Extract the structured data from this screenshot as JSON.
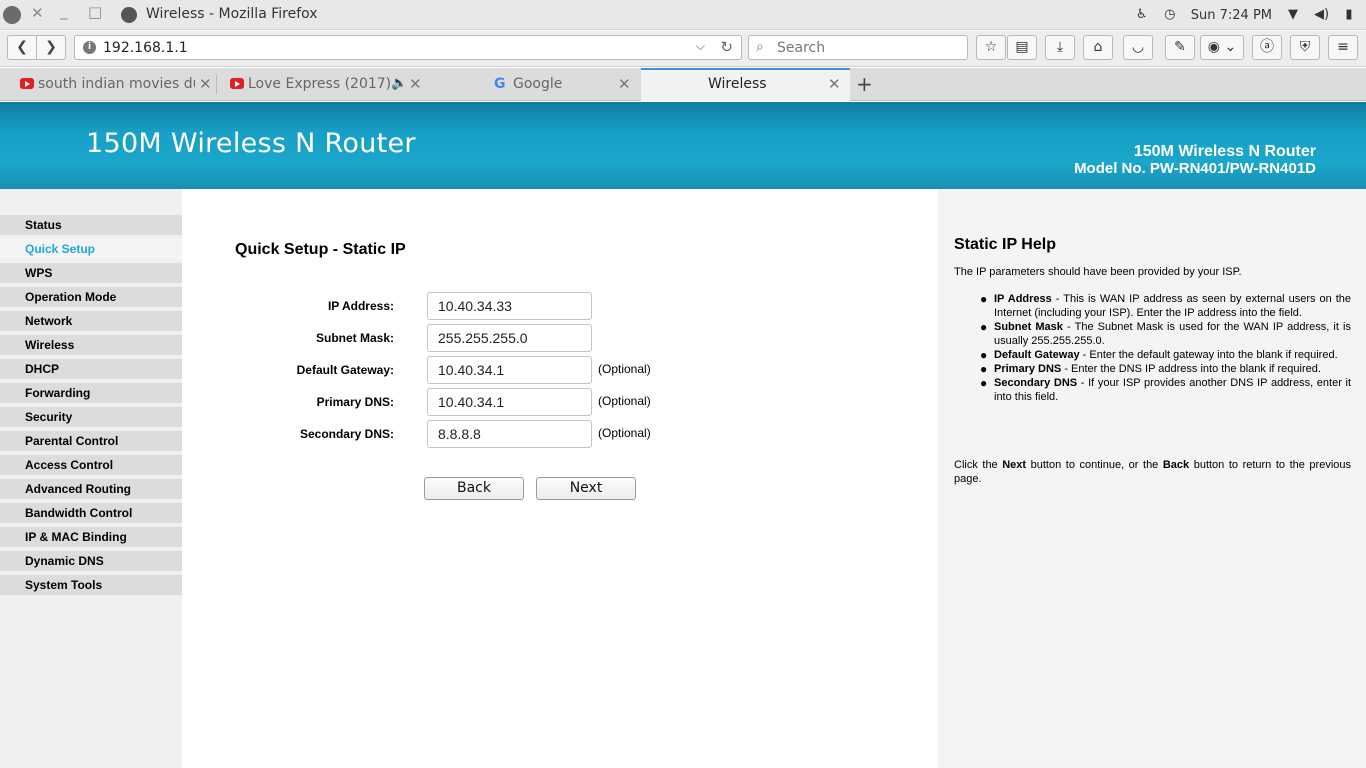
{
  "window": {
    "title": "Wireless - Mozilla Firefox",
    "clock": "Sun  7:24 PM"
  },
  "navbar": {
    "url": "192.168.1.1",
    "search_placeholder": "Search"
  },
  "tabs": [
    {
      "label": "south indian movies dub",
      "favicon": "youtube-icon"
    },
    {
      "label": "Love Express (2017)",
      "favicon": "youtube-icon",
      "audio": true
    },
    {
      "label": "Google",
      "favicon": "google-icon"
    },
    {
      "label": "Wireless",
      "active": true
    }
  ],
  "router_header": {
    "title": "150M Wireless N Router",
    "right_line1": "150M Wireless N Router",
    "right_line2": "Model No. PW-RN401/PW-RN401D"
  },
  "menu": [
    {
      "label": "Status"
    },
    {
      "label": "Quick Setup",
      "active": true
    },
    {
      "label": "WPS"
    },
    {
      "label": "Operation Mode"
    },
    {
      "label": "Network"
    },
    {
      "label": "Wireless"
    },
    {
      "label": "DHCP"
    },
    {
      "label": "Forwarding"
    },
    {
      "label": "Security"
    },
    {
      "label": "Parental Control"
    },
    {
      "label": "Access Control"
    },
    {
      "label": "Advanced Routing"
    },
    {
      "label": "Bandwidth Control"
    },
    {
      "label": "IP & MAC Binding"
    },
    {
      "label": "Dynamic DNS"
    },
    {
      "label": "System Tools"
    }
  ],
  "form": {
    "title": "Quick Setup - Static IP",
    "fields": [
      {
        "label": "IP Address:",
        "value": "10.40.34.33",
        "optional": ""
      },
      {
        "label": "Subnet Mask:",
        "value": "255.255.255.0",
        "optional": ""
      },
      {
        "label": "Default Gateway:",
        "value": "10.40.34.1",
        "optional": "(Optional)"
      },
      {
        "label": "Primary DNS:",
        "value": "10.40.34.1",
        "optional": "(Optional)"
      },
      {
        "label": "Secondary DNS:",
        "value": "8.8.8.8",
        "optional": "(Optional)"
      }
    ],
    "back_label": "Back",
    "next_label": "Next"
  },
  "help": {
    "title": "Static IP Help",
    "intro": "The IP parameters should have been provided by your ISP.",
    "items": [
      {
        "term": "IP Address",
        "text": " - This is WAN IP address as seen by external users on the Internet (including your ISP). Enter the IP address into the field."
      },
      {
        "term": "Subnet Mask",
        "text": " - The Subnet Mask is used for the WAN IP address, it is usually 255.255.255.0."
      },
      {
        "term": "Default Gateway",
        "text": " - Enter the default gateway into the blank if required."
      },
      {
        "term": "Primary DNS",
        "text": " - Enter the DNS IP address into the blank if required."
      },
      {
        "term": "Secondary DNS",
        "text": " - If your ISP provides another DNS IP address, enter it into this field."
      }
    ],
    "footer_pre": "Click the ",
    "footer_next": "Next",
    "footer_mid": " button to continue, or the ",
    "footer_back": "Back",
    "footer_post": " button to return to the previous page."
  }
}
